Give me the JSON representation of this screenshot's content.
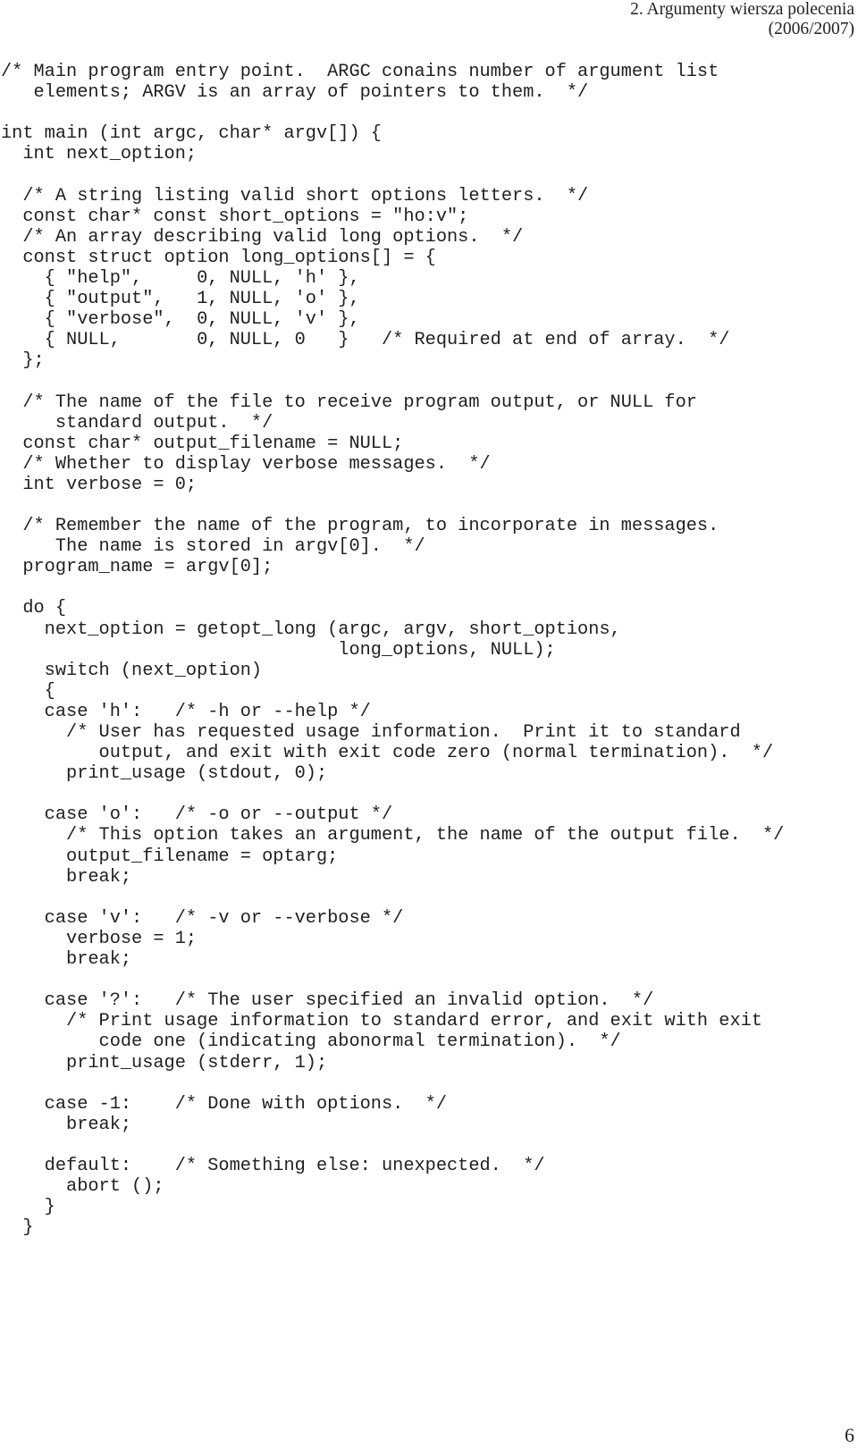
{
  "header": {
    "title": "2. Argumenty wiersza polecenia",
    "subtitle": "(2006/2007)"
  },
  "code": {
    "language": "C",
    "lines": [
      "/* Main program entry point.  ARGC conains number of argument list",
      "   elements; ARGV is an array of pointers to them.  */",
      "",
      "int main (int argc, char* argv[]) {",
      "  int next_option;",
      "",
      "  /* A string listing valid short options letters.  */",
      "  const char* const short_options = \"ho:v\";",
      "  /* An array describing valid long options.  */",
      "  const struct option long_options[] = {",
      "    { \"help\",     0, NULL, 'h' },",
      "    { \"output\",   1, NULL, 'o' },",
      "    { \"verbose\",  0, NULL, 'v' },",
      "    { NULL,       0, NULL, 0   }   /* Required at end of array.  */",
      "  };",
      "",
      "  /* The name of the file to receive program output, or NULL for",
      "     standard output.  */",
      "  const char* output_filename = NULL;",
      "  /* Whether to display verbose messages.  */",
      "  int verbose = 0;",
      "",
      "  /* Remember the name of the program, to incorporate in messages.",
      "     The name is stored in argv[0].  */",
      "  program_name = argv[0];",
      "",
      "  do {",
      "    next_option = getopt_long (argc, argv, short_options,",
      "                               long_options, NULL);",
      "    switch (next_option)",
      "    {",
      "    case 'h':   /* -h or --help */",
      "      /* User has requested usage information.  Print it to standard",
      "         output, and exit with exit code zero (normal termination).  */",
      "      print_usage (stdout, 0);",
      "",
      "    case 'o':   /* -o or --output */",
      "      /* This option takes an argument, the name of the output file.  */",
      "      output_filename = optarg;",
      "      break;",
      "",
      "    case 'v':   /* -v or --verbose */",
      "      verbose = 1;",
      "      break;",
      "",
      "    case '?':   /* The user specified an invalid option.  */",
      "      /* Print usage information to standard error, and exit with exit",
      "         code one (indicating abonormal termination).  */",
      "      print_usage (stderr, 1);",
      "",
      "    case -1:    /* Done with options.  */",
      "      break;",
      "",
      "    default:    /* Something else: unexpected.  */",
      "      abort ();",
      "    }",
      "  }"
    ]
  },
  "footer": {
    "page_number": "6"
  }
}
